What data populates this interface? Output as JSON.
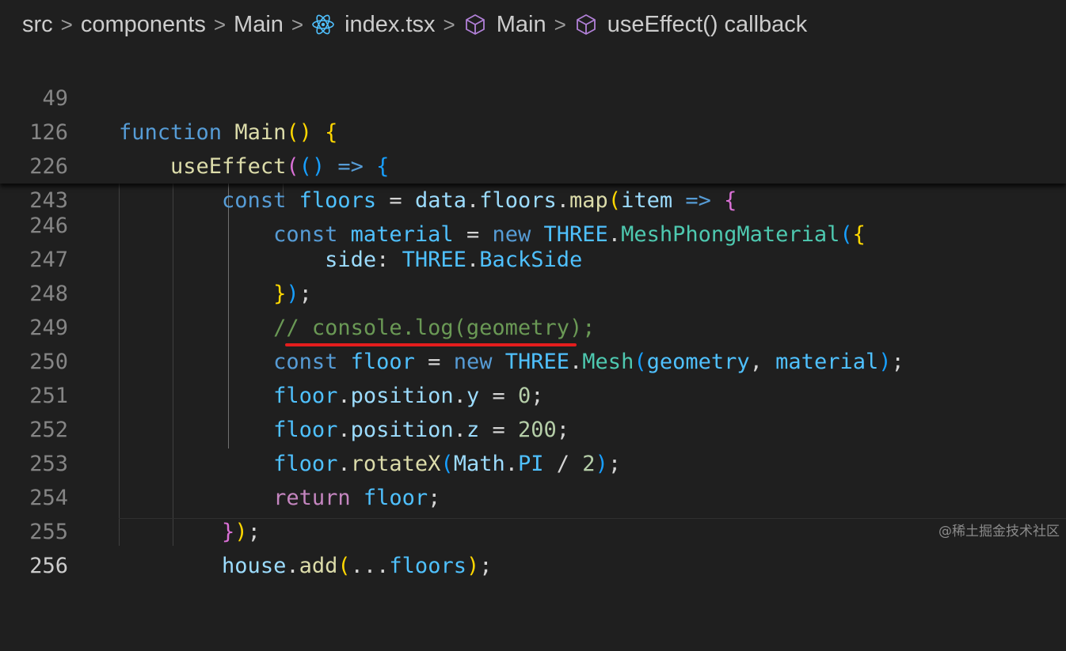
{
  "breadcrumb": {
    "items": [
      {
        "label": "src",
        "icon": ""
      },
      {
        "label": "components",
        "icon": ""
      },
      {
        "label": "Main",
        "icon": ""
      },
      {
        "label": "index.tsx",
        "icon": "react-icon"
      },
      {
        "label": "Main",
        "icon": "symbol-method-icon"
      },
      {
        "label": "useEffect() callback",
        "icon": "symbol-method-icon"
      }
    ],
    "separator": ">"
  },
  "colors": {
    "background": "#1f1f1f",
    "keyword": "#569cd6",
    "control": "#c586c0",
    "function": "#dcdcaa",
    "variable": "#9cdcfe",
    "constant": "#4fc1ff",
    "class": "#4ec9b0",
    "number": "#b5cea8",
    "comment": "#6a9955",
    "bracket_1": "#ffd700",
    "bracket_2": "#da70d6",
    "bracket_3": "#179fff",
    "annotation_underline": "#e41d1d"
  },
  "sticky_scroll": [
    {
      "line": "49",
      "text": "function Main() {"
    },
    {
      "line": "126",
      "text": "    useEffect(() => {"
    },
    {
      "line": "226",
      "text": "        const floors = data.floors.map(item => {"
    },
    {
      "line": "243",
      "text": "            const material = new THREE.MeshPhongMaterial({"
    }
  ],
  "code_lines": [
    {
      "line": "246",
      "text": "                side: THREE.BackSide"
    },
    {
      "line": "247",
      "text": "            });"
    },
    {
      "line": "248",
      "text": "            // console.log(geometry);"
    },
    {
      "line": "249",
      "text": "            const floor = new THREE.Mesh(geometry, material);"
    },
    {
      "line": "250",
      "text": "            floor.position.y = 0;"
    },
    {
      "line": "251",
      "text": "            floor.position.z = 200;"
    },
    {
      "line": "252",
      "text": "            floor.rotateX(Math.PI / 2);"
    },
    {
      "line": "253",
      "text": "            return floor;"
    },
    {
      "line": "254",
      "text": "        });"
    },
    {
      "line": "255",
      "text": "        house.add(...floors);"
    },
    {
      "line": "256",
      "text": ""
    }
  ],
  "current_line": "256",
  "tokens": {
    "function": "function",
    "Main": "Main",
    "useEffect": "useEffect",
    "const": "const",
    "floors": "floors",
    "data": "data",
    "map": "map",
    "item": "item",
    "material": "material",
    "new": "new",
    "THREE": "THREE",
    "MeshPhongMaterial": "MeshPhongMaterial",
    "side": "side",
    "BackSide": "BackSide",
    "comment": "// console.log(geometry);",
    "floor": "floor",
    "Mesh": "Mesh",
    "geometry": "geometry",
    "position": "position",
    "y": "y",
    "z": "z",
    "zero": "0",
    "two_hundred": "200",
    "rotateX": "rotateX",
    "Math": "Math",
    "PI": "PI",
    "two": "2",
    "return": "return",
    "house": "house",
    "add": "add",
    "arrow": "=>",
    "spread": "..."
  },
  "watermark": "@稀土掘金技术社区"
}
